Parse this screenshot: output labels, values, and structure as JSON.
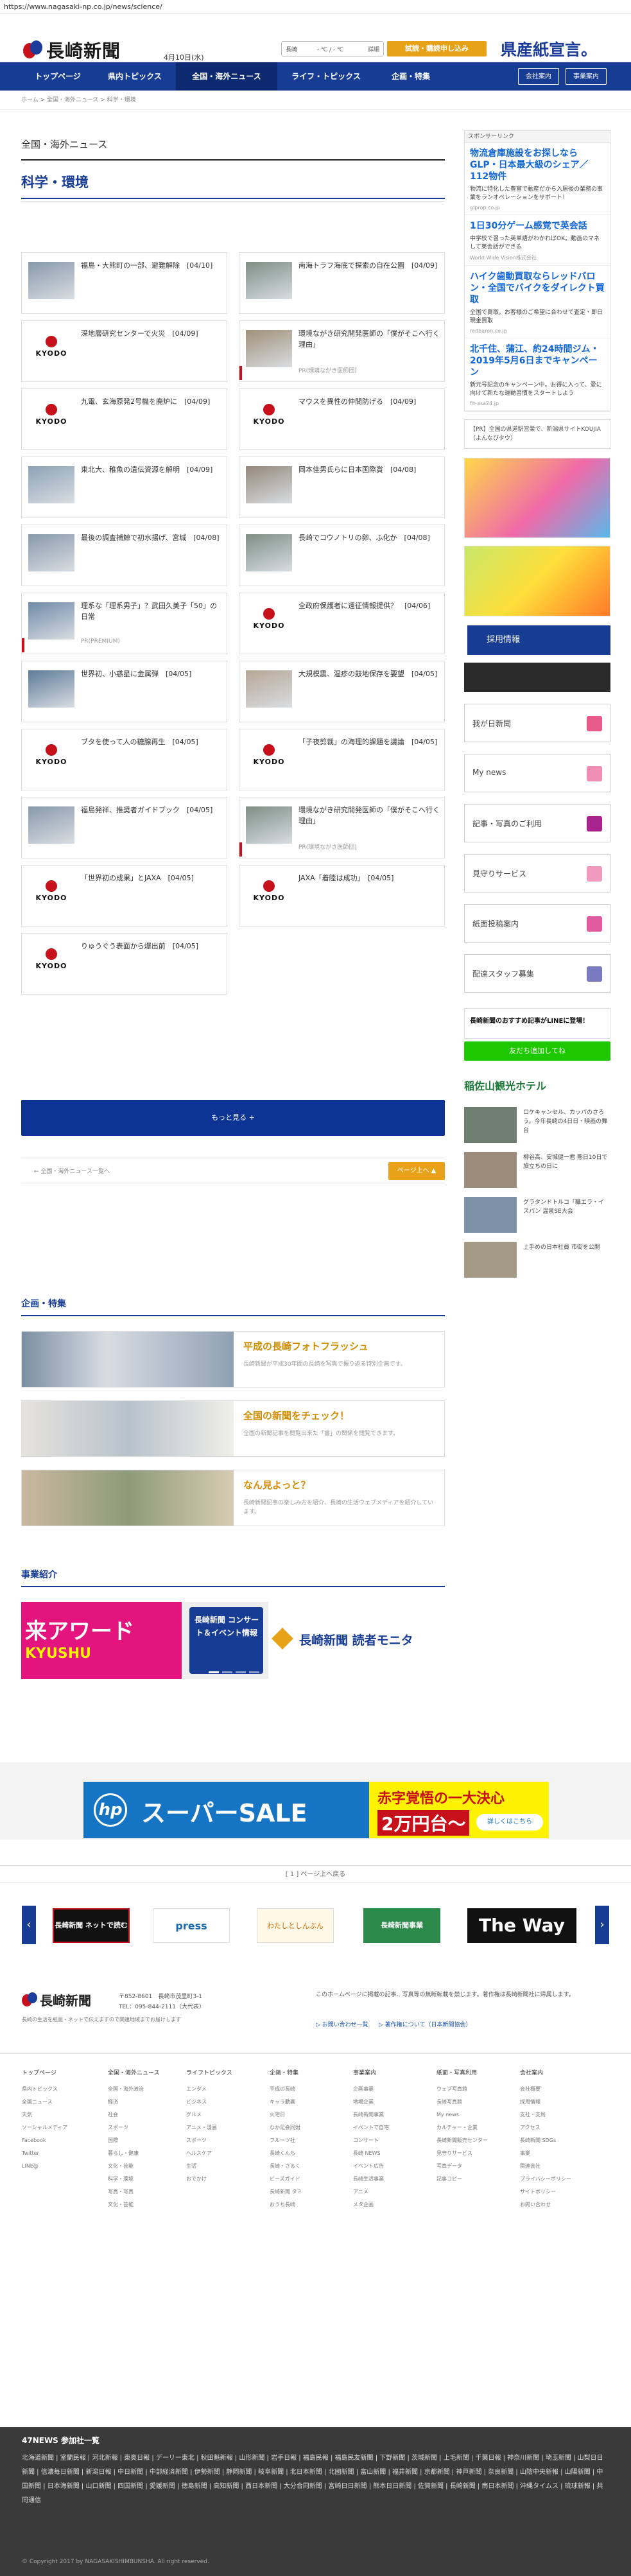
{
  "url": "https://www.nagasaki-np.co.jp/news/science/",
  "header": {
    "date": "4月10日(水)",
    "weather_label": "長崎",
    "weather_value": "- ℃ / - ℃",
    "weather_link": "詳細",
    "trial_button": "試読・購読申し込み",
    "promo_text": "県産紙宣言。",
    "logo_text": "長崎新聞"
  },
  "nav": {
    "items": [
      "トップページ",
      "県内トピックス",
      "全国・海外ニュース",
      "ライフ・トピックス",
      "企画・特集"
    ],
    "active_index": 2,
    "buttons": [
      "会社案内",
      "事業案内"
    ]
  },
  "breadcrumb": "ホーム > 全国・海外ニュース > 科学・環境",
  "section_title": "全国・海外ニュース",
  "subsection_title": "科学・環境",
  "articles": [
    {
      "title": "福島・大熊町の一部、避難解除　[04/10]",
      "thumb": "photo"
    },
    {
      "title": "南海トラフ海底で探索の自在公園　[04/09]",
      "thumb": "photo"
    },
    {
      "title": "深地層研究センターで火災　[04/09]",
      "thumb": "kyodo"
    },
    {
      "title": "環境ながき研究開発医師の「僕がそこへ行く理由」",
      "thumb": "photo",
      "source": "PR(環境ながき医師団)"
    },
    {
      "title": "九電、玄海原発2号機を廃炉に　[04/09]",
      "thumb": "kyodo"
    },
    {
      "title": "マウスを異性の仲間防げる　[04/09]",
      "thumb": "kyodo"
    },
    {
      "title": "東北大、稚魚の遺伝資源を解明　[04/09]",
      "thumb": "photo"
    },
    {
      "title": "岡本佳男氏らに日本国際賞　[04/08]",
      "thumb": "photo"
    },
    {
      "title": "最後の調査捕鯨で初水揚げ、宮城　[04/08]",
      "thumb": "photo"
    },
    {
      "title": "長崎でコウノトリの卵、ふ化か　[04/08]",
      "thumb": "photo"
    },
    {
      "title": "理系な「理系男子」？武田久美子「50」の日常",
      "thumb": "photo",
      "source": "PR(PREMIUM)"
    },
    {
      "title": "全政府保護者に遠征情報提供？　[04/06]",
      "thumb": "kyodo"
    },
    {
      "title": "世界初、小惑星に金属弾　[04/05]",
      "thumb": "photo"
    },
    {
      "title": "大規模震、湿疹の鼓地保存を要望　[04/05]",
      "thumb": "photo"
    },
    {
      "title": "ブタを使って人の糖腺再生　[04/05]",
      "thumb": "kyodo"
    },
    {
      "title": "「子夜剪裁」の海理的課題を議論　[04/05]",
      "thumb": "kyodo"
    },
    {
      "title": "福島発祥、推奨者ガイドブック　[04/05]",
      "thumb": "photo"
    },
    {
      "title": "環境ながき研究開発医師の「僕がそこへ行く理由」",
      "thumb": "photo",
      "source": "PR(環境ながき医師団)"
    },
    {
      "title": "「世界初の成果」とJAXA　[04/05]",
      "thumb": "kyodo"
    },
    {
      "title": "JAXA「着陸は成功」　[04/05]",
      "thumb": "kyodo"
    },
    {
      "title": "りゅうぐう表面から爆出前　[04/05]",
      "thumb": "kyodo"
    }
  ],
  "more_button": "もっと見る +",
  "back_link": "← 全国・海外ニュース一覧へ",
  "page_top": "ページ上へ ▲",
  "features_title": "企画・特集",
  "features": [
    {
      "title": "平成の長崎フォトフラッシュ",
      "desc": "長崎新聞が平成30年間の長崎を写真で振り返る特別企画です。"
    },
    {
      "title": "全国の新聞をチェック！",
      "desc": "全国の新聞記事を閲覧出来た「書」の関係を閲覧できます。"
    },
    {
      "title": "なん見よっと？",
      "desc": "長崎新聞記事の楽しみ方を紹介、長崎の生活ウェブメディアを紹介しています。"
    }
  ],
  "business_title": "事業紹介",
  "biz_banner_texts": [
    "来アワード",
    "KYUSHU",
    "長崎新聞 コンサート＆イベント情報",
    "長崎新聞 読者モニタ"
  ],
  "ad_sale": {
    "main": "スーパーSALE",
    "sub": "赤字覚悟の一大決心",
    "price": "2万円台〜",
    "cta": "詳しくはこちら"
  },
  "page_counter": "[ 1 ] ページ上へ戻る",
  "partners": [
    "長崎新聞 ネットで読む",
    "press",
    "わたしとしんぶん",
    "長崎新聞事業",
    "The Way"
  ],
  "sidebar": {
    "sponsor_label": "スポンサーリンク",
    "ads": [
      {
        "headline": "物流倉庫施設をお探しならGLP・日本最大級のシェア／112物件",
        "body": "物流に特化した豊富で動産だから入居後の業務の事業をランオペレーションをサポート！",
        "domain": "glprop.co.jp"
      },
      {
        "headline": "1日30分ゲーム感覚で英会話",
        "body": "中学校で習った英単語がわかればOK。動画のマネして英会話ができる",
        "domain": "World Wide Vision株式会社"
      },
      {
        "headline": "ハイク歯動買取ならレッドバロン・全国でバイクをダイレクト買取",
        "body": "全国で買取。お客様のご希望に合わせて査定・即日現金買取",
        "domain": "redbaron.co.jp"
      },
      {
        "headline": "北千住、蒲江、約24時間ジム・2019年5月6日までキャンペーン",
        "body": "新元号記念のキャンペーン中。お得に入って、愛に向けて新たな運動習慣をスタートしよう",
        "domain": "fit-asa24.jp"
      }
    ],
    "pr_note": "【PR】全国の県道駅営業で、新潟県サイトKOUJIA（よんなびタウ）",
    "recruit_label": "採用情報",
    "links": [
      {
        "label": "我が日新聞",
        "color": "#e85a8a"
      },
      {
        "label": "My news",
        "color": "#f08fb6"
      },
      {
        "label": "記事・写真のご利用",
        "color": "#a7238e"
      },
      {
        "label": "見守りサービス",
        "color": "#f09ac0"
      },
      {
        "label": "紙面投稿案内",
        "color": "#e05aa0"
      },
      {
        "label": "配達スタッフ募集",
        "color": "#7a7ac0"
      }
    ],
    "line_label": "長崎新聞のおすすめ記事がLINEに登場！",
    "line_button": "友だち追加してね",
    "hotel": "稲佐山観光ホテル",
    "topics": [
      {
        "text": "ロケキャンセル、カッパのさろう。今年長崎の4日日・映画の舞台"
      },
      {
        "text": "柳谷高、安城健一君 熊日10日で旅立ちの日に"
      },
      {
        "text": "グラタンドトルコ「職エラ・イスパン 温泉SE大会"
      },
      {
        "text": "上手めの日本社員 市街を公開"
      }
    ]
  },
  "footer": {
    "address": "〒852-8601　長崎市茂里町3-1",
    "tel": "TEL：095-844-2111（大代表）",
    "note": "長崎の生活を紙面・ネットで伝えますので関連地域までお届けします",
    "policy": "このホームページに掲載の記事、写真等の無断転載を禁じます。著作権は長崎新聞社に帰属します。",
    "policy_links": [
      "▷ お問い合わせ一覧",
      "▷ 著作権について（日本新聞協会）"
    ],
    "cols": [
      {
        "h": "トップページ",
        "items": [
          "県内トピックス",
          "全国ニュース",
          "天気",
          "ソーシャルメディア",
          "Facebook",
          "Twitter",
          "LINE@"
        ]
      },
      {
        "h": "全国・海外ニュース",
        "items": [
          "全国・海外政治",
          "経済",
          "社会",
          "スポーツ",
          "国際",
          "暮らし・健康",
          "文化・芸能",
          "科学・環境",
          "写真・写真",
          "文化・芸能"
        ]
      },
      {
        "h": "ライフトピックス",
        "items": [
          "エンタメ",
          "ビジネス",
          "グルメ",
          "アニメ・漫画",
          "スポーツ",
          "ヘルスケア",
          "生活",
          "おでかけ"
        ]
      },
      {
        "h": "企画・特集",
        "items": [
          "平成の長崎",
          "キャラ動画",
          "火宅日",
          "なか足会同財",
          "フルーツ社",
          "長崎くんち",
          "長崎・さるく",
          "ビーズガイド",
          "長崎新聞 タミ",
          "おうち長崎"
        ]
      },
      {
        "h": "事業案内",
        "items": [
          "企画事業",
          "地場企業",
          "長崎新聞事業",
          "イベントで自宅",
          "コンサート",
          "長崎 NEWS",
          "イベント広告",
          "長崎生活事業",
          "アニメ",
          "メタ企画"
        ]
      },
      {
        "h": "紙面・写真利用",
        "items": [
          "ウェブ写真館",
          "長崎写真館",
          "My news",
          "カルチャー・企業",
          "長崎新聞販売センター",
          "見守りサービス",
          "写真データ",
          "記事コピー"
        ]
      },
      {
        "h": "会社案内",
        "items": [
          "会社概要",
          "採用情報",
          "支社・支局",
          "アクセス",
          "長崎新聞 SDGs",
          "事業",
          "関連会社",
          "プライバシーポリシー",
          "サイトポリシー",
          "お問い合わせ"
        ]
      }
    ],
    "np47_title": "47NEWS 参加社一覧",
    "np47": "北海道新聞 | 室蘭民報 | 河北新報 | 東奥日報 | デーリー東北 | 秋田魁新報 | 山形新聞 | 岩手日報 | 福島民報 | 福島民友新聞 | 下野新聞 | 茨城新聞 | 上毛新聞 | 千葉日報 | 神奈川新聞 | 埼玉新聞 | 山梨日日新聞 | 信濃毎日新聞 | 新潟日報 | 中日新聞 | 中部経済新聞 | 伊勢新聞 | 静岡新聞 | 岐阜新聞 | 北日本新聞 | 北國新聞 | 富山新聞 | 福井新聞 | 京都新聞 | 神戸新聞 | 奈良新聞 | 山陰中央新報 | 山陽新聞 | 中国新聞 | 日本海新聞 | 山口新聞 | 四国新聞 | 愛媛新聞 | 徳島新聞 | 高知新聞 | 西日本新聞 | 大分合同新聞 | 宮崎日日新聞 | 熊本日日新聞 | 佐賀新聞 | 長崎新聞 | 南日本新聞 | 沖縄タイムス | 琉球新報 | 共同通信",
    "copyright": "© Copyright 2017 by NAGASAKISHIMBUNSHA. All right reserved."
  }
}
